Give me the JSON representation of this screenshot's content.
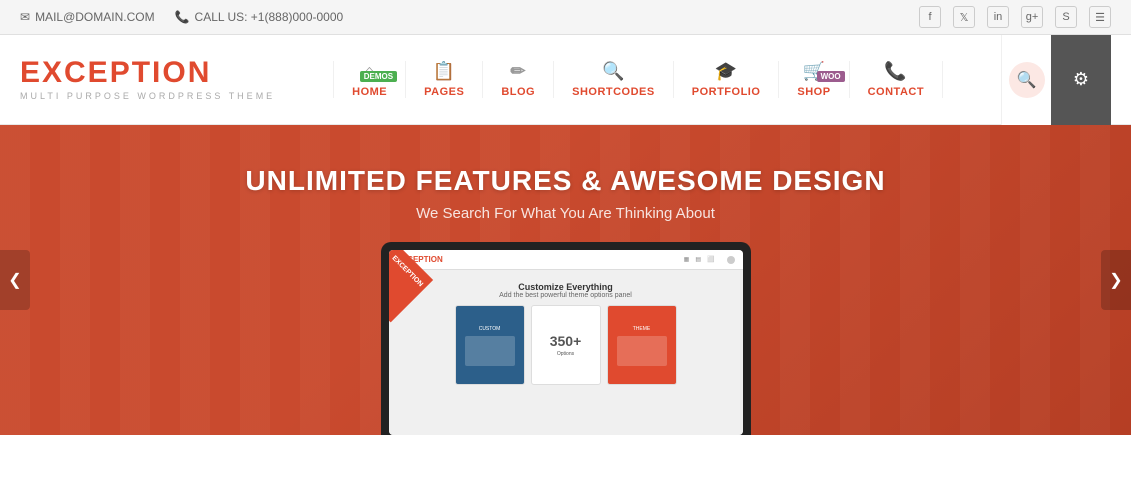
{
  "topbar": {
    "email_icon": "✉",
    "email": "MAIL@DOMAIN.COM",
    "phone_icon": "📞",
    "phone": "CALL US: +1(888)000-0000",
    "socials": [
      {
        "name": "facebook",
        "icon": "f"
      },
      {
        "name": "twitter",
        "icon": "t"
      },
      {
        "name": "linkedin",
        "icon": "in"
      },
      {
        "name": "google-plus",
        "icon": "g+"
      },
      {
        "name": "skype",
        "icon": "s"
      },
      {
        "name": "rss",
        "icon": "rss"
      }
    ]
  },
  "logo": {
    "title": "EXCEPTION",
    "subtitle": "MULTI PURPOSE WORDPRESS THEME"
  },
  "nav": {
    "items": [
      {
        "id": "home",
        "icon": "⌂",
        "label": "HOME",
        "badge": "DEMOS",
        "badge_color": "#4caf50"
      },
      {
        "id": "pages",
        "icon": "📄",
        "label": "PAGES"
      },
      {
        "id": "blog",
        "icon": "✏",
        "label": "BLOG"
      },
      {
        "id": "shortcodes",
        "icon": "🔍",
        "label": "SHORTCODES"
      },
      {
        "id": "portfolio",
        "icon": "🎓",
        "label": "PORTFOLIO"
      },
      {
        "id": "shop",
        "icon": "🛒",
        "label": "SHOP",
        "badge": "WOO",
        "badge_color": "#9c5c8e"
      },
      {
        "id": "contact",
        "icon": "📞",
        "label": "CONTACT"
      }
    ],
    "search_label": "🔍",
    "settings_label": "⚙"
  },
  "hero": {
    "title": "UNLIMITED FEATURES & AWESOME DESIGN",
    "subtitle": "We Search For What You Are Thinking About",
    "prev_arrow": "❮",
    "next_arrow": "❯"
  },
  "screen": {
    "logo": "EXCEPTION",
    "title": "Customize Everything",
    "subtitle": "Add the best powerful theme options panel",
    "badge": "EXCEPTION",
    "card1_label": "CUSTOM",
    "card2_num": "350+",
    "card2_label": "Options",
    "card3_label": "THEME"
  }
}
